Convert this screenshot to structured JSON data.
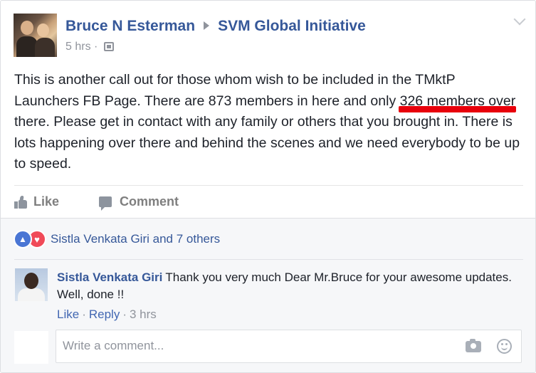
{
  "post": {
    "author": "Bruce N Esterman",
    "group": "SVM Global Initiative",
    "time": "5 hrs",
    "separator": "·",
    "text": "This is another call out for those whom wish to be included in the TMktP Launchers FB Page. There are 873 members in here and only 326 members over there. Please get in contact with any family or others that you brought in. There is lots happening over there and behind the scenes and we need everybody to be up to speed.",
    "highlight_color": "#e8000b"
  },
  "actions": {
    "like_label": "Like",
    "comment_label": "Comment"
  },
  "reactions": {
    "summary": "Sistla Venkata Giri and 7 others",
    "types": [
      "like",
      "love"
    ]
  },
  "comments": [
    {
      "author": "Sistla Venkata Giri",
      "text": "Thank you very much Dear Mr.Bruce for your awesome updates. Well, done !!",
      "like_label": "Like",
      "reply_label": "Reply",
      "time": "3 hrs"
    }
  ],
  "composer": {
    "placeholder": "Write a comment..."
  },
  "colors": {
    "link": "#365899",
    "muted": "#90949c",
    "background_gray": "#f6f7f9"
  }
}
